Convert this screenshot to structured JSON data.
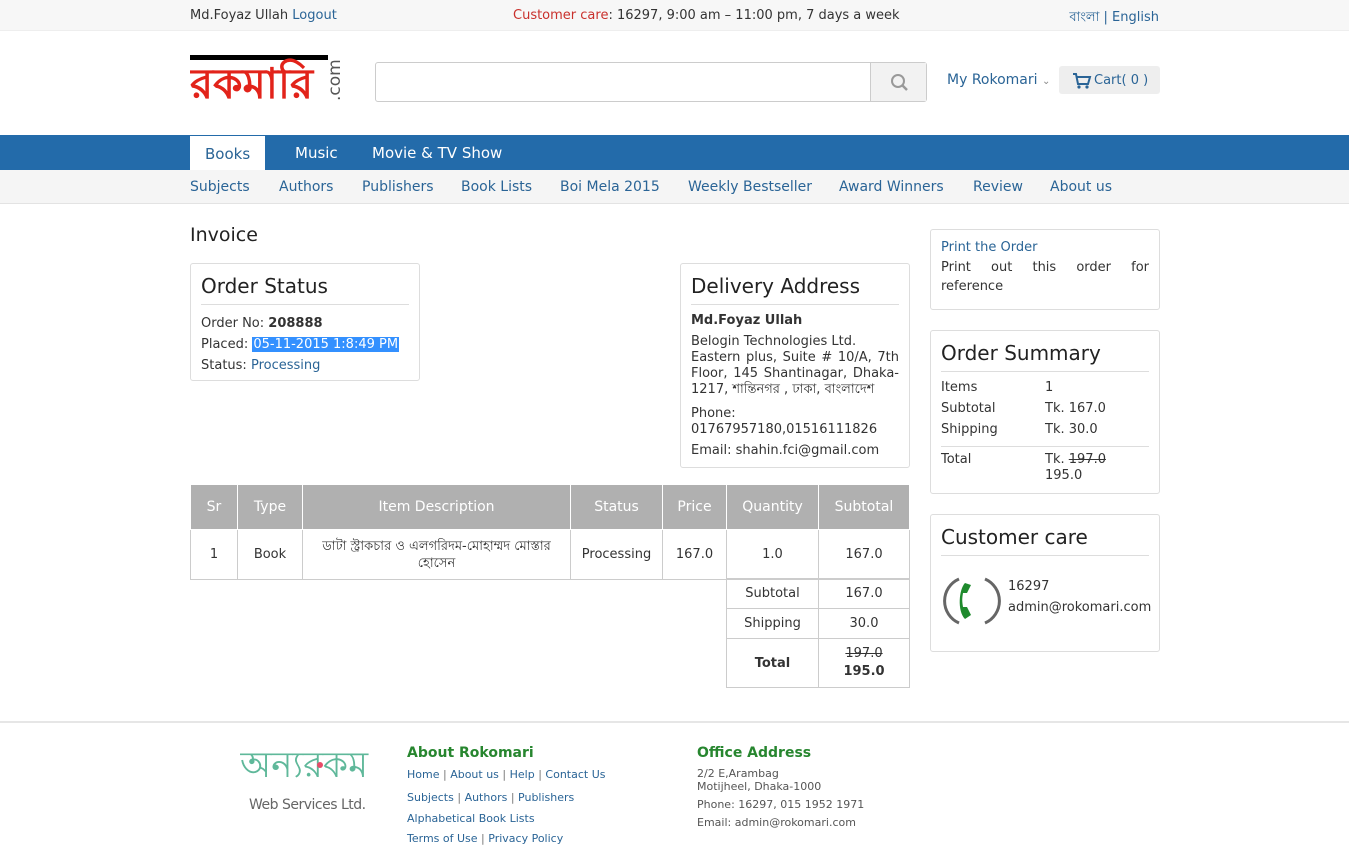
{
  "topbar": {
    "user_name": "Md.Foyaz Ullah",
    "logout": "Logout",
    "care_label": "Customer care",
    "care_text": ": 16297, 9:00 am – 11:00 pm, 7 days a week",
    "lang_bn": "বাংলা",
    "lang_sep": "|",
    "lang_en": "English"
  },
  "header": {
    "logo_text": "রকমারি",
    "logo_com": ".com",
    "search_placeholder": "",
    "my_account": "My Rokomari",
    "cart_label": "Cart( 0 )"
  },
  "nav": {
    "tabs": [
      {
        "label": "Books"
      },
      {
        "label": "Music"
      },
      {
        "label": "Movie & TV Show"
      }
    ],
    "sub": [
      {
        "label": "Subjects"
      },
      {
        "label": "Authors"
      },
      {
        "label": "Publishers"
      },
      {
        "label": "Book Lists"
      },
      {
        "label": "Boi Mela 2015"
      },
      {
        "label": "Weekly Bestseller"
      },
      {
        "label": "Award Winners"
      },
      {
        "label": "Review"
      },
      {
        "label": "About us"
      }
    ]
  },
  "invoice": {
    "title": "Invoice",
    "order_status": {
      "heading": "Order Status",
      "order_no_label": "Order No:",
      "order_no": "208888",
      "placed_label": "Placed:",
      "placed": "05-11-2015 1:8:49 PM",
      "status_label": "Status:",
      "status": "Processing"
    },
    "delivery": {
      "heading": "Delivery Address",
      "name": "Md.Foyaz Ullah",
      "company": "Belogin Technologies Ltd.",
      "address": "Eastern plus, Suite # 10/A, 7th Floor, 145 Shantinagar, Dhaka-1217, শান্তিনগর , ঢাকা, বাংলাদেশ",
      "phone_label": "Phone:",
      "phone": "01767957180,01516111826",
      "email_label": "Email:",
      "email": "shahin.fci@gmail.com"
    },
    "table": {
      "headers": [
        "Sr",
        "Type",
        "Item Description",
        "Status",
        "Price",
        "Quantity",
        "Subtotal"
      ],
      "rows": [
        {
          "sr": "1",
          "type": "Book",
          "desc": "ডাটা স্ট্রাকচার ও এলগরিদম-মোহাম্মদ মোস্তার হোসেন",
          "status": "Processing",
          "price": "167.0",
          "qty": "1.0",
          "subtotal": "167.0"
        }
      ],
      "totals": {
        "subtotal_label": "Subtotal",
        "subtotal": "167.0",
        "shipping_label": "Shipping",
        "shipping": "30.0",
        "total_label": "Total",
        "total_old": "197.0",
        "total": "195.0"
      }
    }
  },
  "sidebar": {
    "print_link": "Print the Order",
    "print_text": "Print out this order for reference",
    "summary": {
      "heading": "Order Summary",
      "items_label": "Items",
      "items": "1",
      "subtotal_label": "Subtotal",
      "subtotal": "Tk. 167.0",
      "shipping_label": "Shipping",
      "shipping": "Tk. 30.0",
      "total_label": "Total",
      "total_prefix": "Tk.",
      "total_old": "197.0",
      "total": "195.0"
    },
    "care": {
      "heading": "Customer care",
      "phone": "16297",
      "email": "admin@rokomari.com"
    }
  },
  "footer": {
    "logo_text": "অন্যরকম",
    "logo_sub": "Web Services Ltd.",
    "about_heading": "About Rokomari",
    "links1": [
      "Home",
      "About us",
      "Help",
      "Contact Us"
    ],
    "links2": [
      "Subjects",
      "Authors",
      "Publishers"
    ],
    "links3": [
      "Alphabetical Book Lists"
    ],
    "links4": [
      "Terms of Use",
      "Privacy Policy"
    ],
    "office_heading": "Office Address",
    "office_line1": "2/2 E,Arambag",
    "office_line2": "Motijheel, Dhaka-1000",
    "office_phone": "Phone: 16297, 015 1952 1971",
    "office_email": "Email: admin@rokomari.com"
  },
  "colors": {
    "nav_blue": "#236baa",
    "link_blue": "#2a6496",
    "care_red": "#c9302c",
    "footer_green": "#27862f",
    "selection": "#3390ff"
  }
}
